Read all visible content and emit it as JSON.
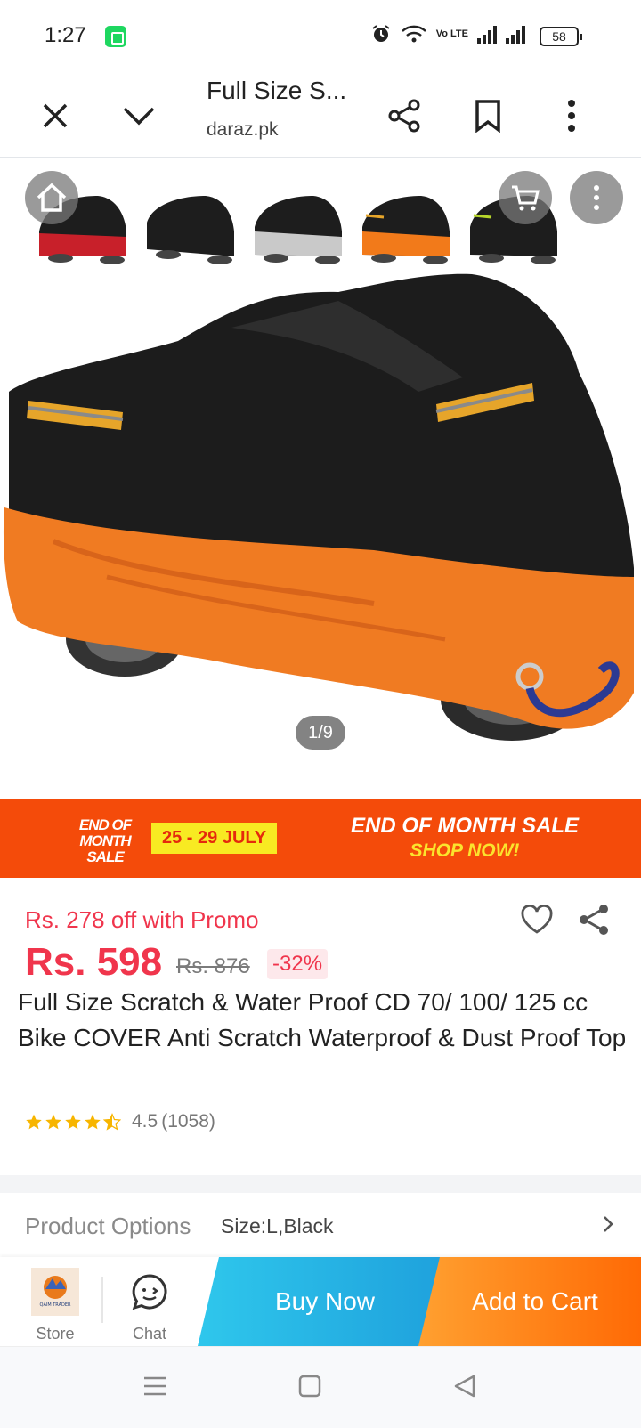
{
  "status_bar": {
    "time": "1:27",
    "network_label": "Vo LTE",
    "battery": "58"
  },
  "browser": {
    "title": "Full Size S...",
    "url": "daraz.pk"
  },
  "gallery": {
    "counter": "1/9",
    "thumbnails": [
      {
        "accent": "#c8202a"
      },
      {
        "accent": "#1c1c1c"
      },
      {
        "accent": "#c9c9c9"
      },
      {
        "accent": "#f27a1a"
      },
      {
        "accent": "#1c1c1c"
      }
    ]
  },
  "banner": {
    "left_text": "END OF MONTH SALE",
    "dates": "25 - 29 JULY",
    "headline": "END OF MONTH SALE",
    "cta": "SHOP NOW!"
  },
  "product": {
    "promo": "Rs. 278 off with Promo",
    "price": "Rs. 598",
    "old_price": "Rs. 876",
    "discount": "-32%",
    "title": "Full Size Scratch & Water Proof CD 70/ 100/ 125 cc Bike COVER Anti Scratch Waterproof & Dust Proof Top",
    "rating": "4.5",
    "rating_count": "(1058)",
    "stars": 4.5
  },
  "options": {
    "label": "Product Options",
    "value": "Size:L,Black"
  },
  "actions": {
    "store_label": "Store",
    "store_logo_text": "QAIM TRADER",
    "chat_label": "Chat",
    "buy_now": "Buy Now",
    "add_to_cart": "Add to Cart"
  },
  "colors": {
    "price_red": "#f0354c",
    "banner_orange": "#f44b0a",
    "buy_blue": "#1ea0dc",
    "cart_orange": "#ff6a05"
  }
}
